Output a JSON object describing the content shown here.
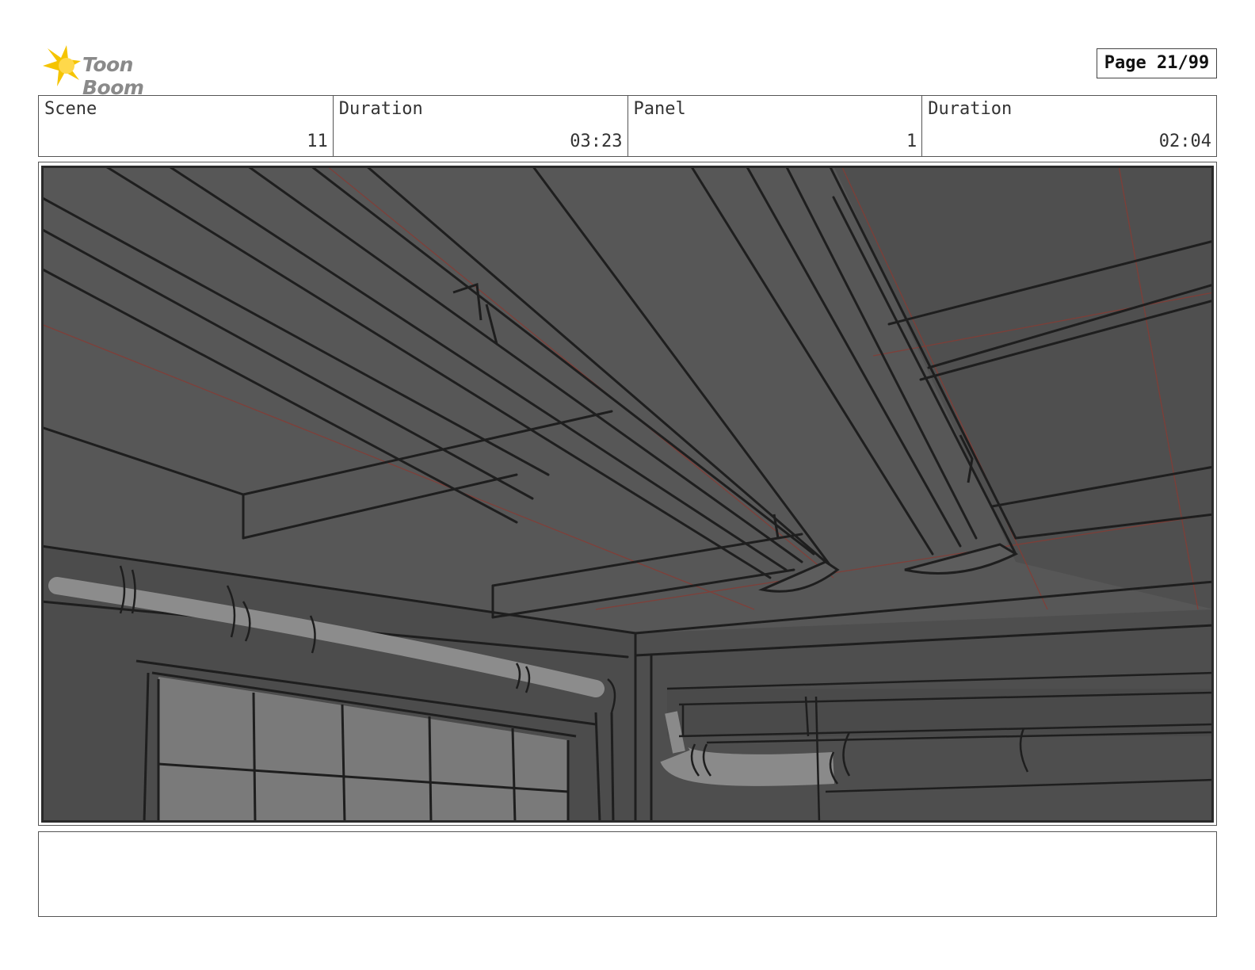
{
  "header": {
    "logo_text": "Toon Boom",
    "page_label": "Page 21/99"
  },
  "info": {
    "scene_label": "Scene",
    "scene_value": "11",
    "scene_duration_label": "Duration",
    "scene_duration_value": "03:23",
    "panel_label": "Panel",
    "panel_value": "1",
    "panel_duration_label": "Duration",
    "panel_duration_value": "02:04"
  },
  "notes": {
    "text": ""
  },
  "colors": {
    "logo_yellow": "#f5c400",
    "sketch_bg": "#575757",
    "line": "#1e1e1e",
    "guide_red": "#8a3a32"
  }
}
